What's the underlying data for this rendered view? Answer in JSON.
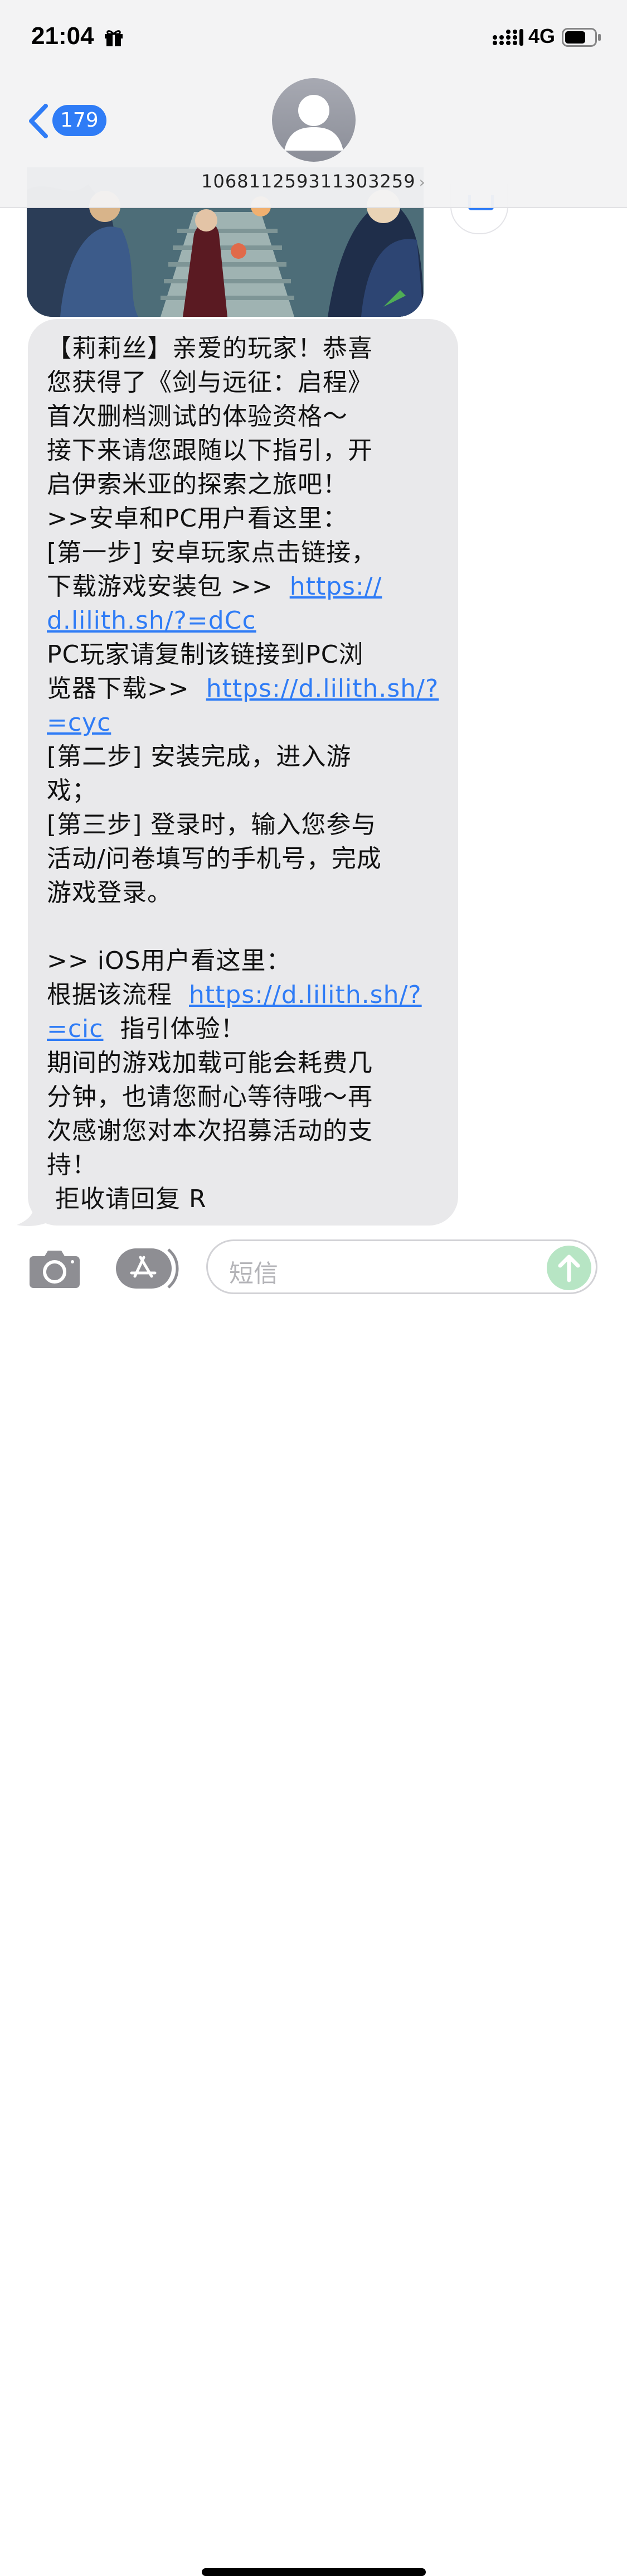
{
  "status_bar": {
    "time": "21:04",
    "network": "4G",
    "gift_icon": "gift-icon",
    "signal_icon": "signal-icon",
    "battery_icon": "battery-icon"
  },
  "header": {
    "back_count": "179",
    "contact_number": "106811259311303259",
    "avatar_icon": "person-icon"
  },
  "message": {
    "lines": [
      {
        "parts": [
          {
            "text": "【莉莉丝】亲爱的玩家！恭喜"
          }
        ]
      },
      {
        "parts": [
          {
            "text": "您获得了《剑与远征：启程》"
          }
        ]
      },
      {
        "parts": [
          {
            "text": "首次删档测试的体验资格～"
          }
        ]
      },
      {
        "parts": [
          {
            "text": "接下来请您跟随以下指引，开"
          }
        ]
      },
      {
        "parts": [
          {
            "text": "启伊索米亚的探索之旅吧！"
          }
        ]
      },
      {
        "parts": [
          {
            "text": ">>安卓和PC用户看这里："
          }
        ]
      },
      {
        "parts": [
          {
            "text": "[第一步] 安卓玩家点击链接，"
          }
        ]
      },
      {
        "parts": [
          {
            "text": "下载游戏安装包 >>  "
          },
          {
            "text": "https://",
            "link": true
          }
        ]
      },
      {
        "parts": [
          {
            "text": "d.lilith.sh/?=dCc",
            "link": true
          }
        ]
      },
      {
        "parts": [
          {
            "text": "PC玩家请复制该链接到PC浏"
          }
        ]
      },
      {
        "parts": [
          {
            "text": "览器下载>>  "
          },
          {
            "text": "https://d.lilith.sh/?",
            "link": true
          }
        ]
      },
      {
        "parts": [
          {
            "text": "=cyc",
            "link": true
          }
        ]
      },
      {
        "parts": [
          {
            "text": "[第二步] 安装完成，进入游"
          }
        ]
      },
      {
        "parts": [
          {
            "text": "戏；"
          }
        ]
      },
      {
        "parts": [
          {
            "text": "[第三步] 登录时，输入您参与"
          }
        ]
      },
      {
        "parts": [
          {
            "text": "活动/问卷填写的手机号，完成"
          }
        ]
      },
      {
        "parts": [
          {
            "text": "游戏登录。"
          }
        ]
      },
      {
        "parts": [
          {
            "text": " "
          }
        ]
      },
      {
        "parts": [
          {
            "text": ">> iOS用户看这里："
          }
        ]
      },
      {
        "parts": [
          {
            "text": "根据该流程  "
          },
          {
            "text": "https://d.lilith.sh/?",
            "link": true
          }
        ]
      },
      {
        "parts": [
          {
            "text": "=cic",
            "link": true
          },
          {
            "text": "  指引体验！"
          }
        ]
      },
      {
        "parts": [
          {
            "text": "期间的游戏加载可能会耗费几"
          }
        ]
      },
      {
        "parts": [
          {
            "text": "分钟，也请您耐心等待哦～再"
          }
        ]
      },
      {
        "parts": [
          {
            "text": "次感谢您对本次招募活动的支"
          }
        ]
      },
      {
        "parts": [
          {
            "text": "持！"
          }
        ]
      },
      {
        "parts": [
          {
            "text": " 拒收请回复 R"
          }
        ]
      }
    ]
  },
  "input_bar": {
    "placeholder": "短信",
    "camera_icon": "camera-icon",
    "apps_icon": "app-store-icon",
    "send_icon": "send-arrow-icon"
  },
  "colors": {
    "accent": "#2f7cf6",
    "bubble": "#e9e9eb",
    "send_disabled": "#b7e5c4"
  }
}
